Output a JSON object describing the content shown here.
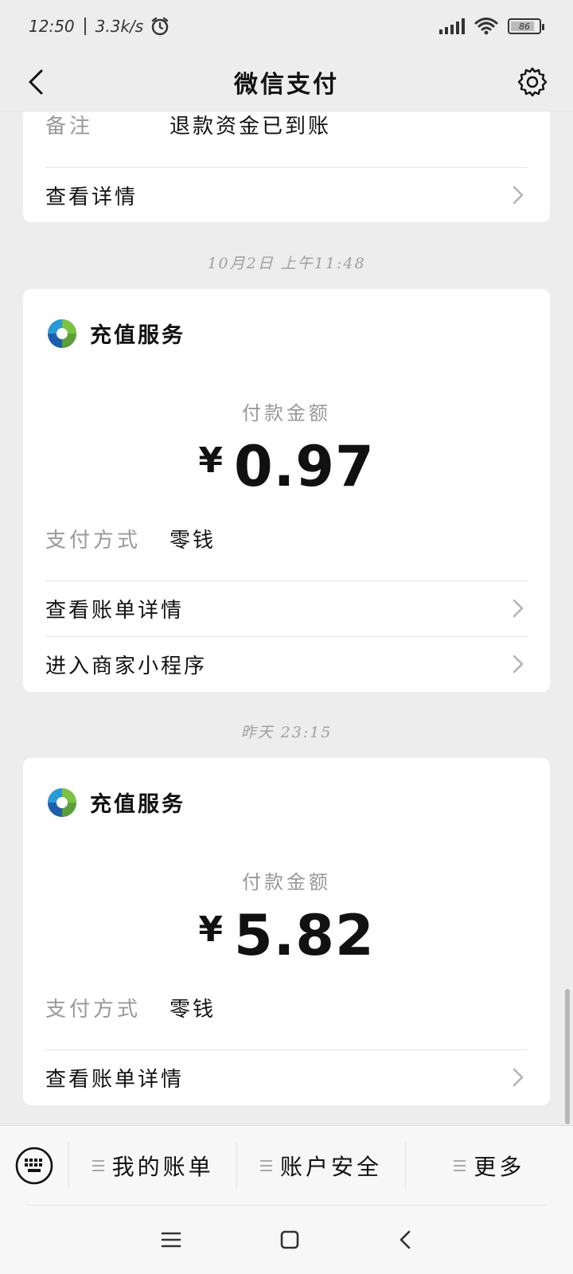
{
  "status_bar": {
    "time": "12:50",
    "speed": "3.3k/s",
    "battery": "86",
    "battery_level": 0.86
  },
  "nav": {
    "title": "微信支付"
  },
  "partial_card": {
    "remark_label": "备注",
    "remark_value": "退款资金已到账",
    "details_link": "查看详情"
  },
  "timestamps": [
    "10月2日 上午11:48",
    "昨天 23:15"
  ],
  "payments": [
    {
      "merchant": "充值服务",
      "amount_label": "付款金额",
      "currency": "¥",
      "amount": "0.97",
      "method_label": "支付方式",
      "method_value": "零钱",
      "links": [
        "查看账单详情",
        "进入商家小程序"
      ]
    },
    {
      "merchant": "充值服务",
      "amount_label": "付款金额",
      "currency": "¥",
      "amount": "5.82",
      "method_label": "支付方式",
      "method_value": "零钱",
      "links": [
        "查看账单详情"
      ]
    }
  ],
  "bottom_tabs": [
    "我的账单",
    "账户安全",
    "更多"
  ],
  "icons": {
    "back": "chevron-left-icon",
    "settings": "gear-icon",
    "keyboard": "keyboard-icon",
    "chevron": "chevron-right-icon"
  }
}
